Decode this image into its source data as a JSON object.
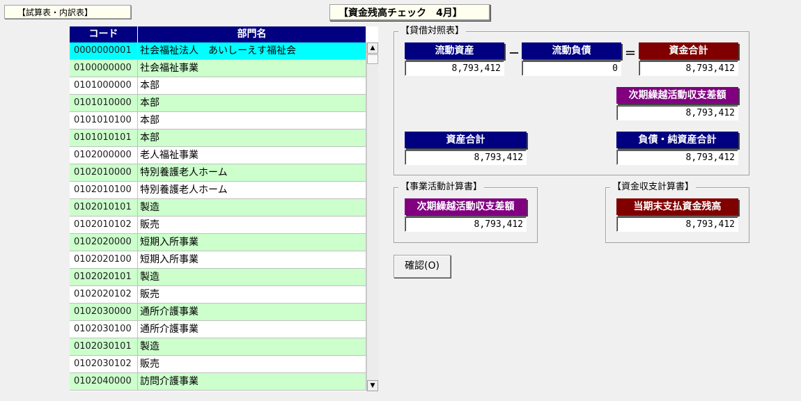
{
  "header": {
    "tab_label": "【試算表・内訳表】",
    "screen_title": "【資金残高チェック　4月】"
  },
  "grid": {
    "columns": [
      "コード",
      "部門名"
    ],
    "rows": [
      {
        "code": "0000000001",
        "name": "社会福祉法人　あいしーえす福祉会",
        "state": "selected"
      },
      {
        "code": "0100000000",
        "name": "社会福祉事業",
        "state": "green"
      },
      {
        "code": "0101000000",
        "name": "本部",
        "state": "white"
      },
      {
        "code": "0101010000",
        "name": "本部",
        "state": "green"
      },
      {
        "code": "0101010100",
        "name": "本部",
        "state": "white"
      },
      {
        "code": "0101010101",
        "name": "本部",
        "state": "green"
      },
      {
        "code": "0102000000",
        "name": "老人福祉事業",
        "state": "white"
      },
      {
        "code": "0102010000",
        "name": "特別養護老人ホーム",
        "state": "green"
      },
      {
        "code": "0102010100",
        "name": "特別養護老人ホーム",
        "state": "white"
      },
      {
        "code": "0102010101",
        "name": "製造",
        "state": "green"
      },
      {
        "code": "0102010102",
        "name": "販売",
        "state": "white"
      },
      {
        "code": "0102020000",
        "name": "短期入所事業",
        "state": "green"
      },
      {
        "code": "0102020100",
        "name": "短期入所事業",
        "state": "white"
      },
      {
        "code": "0102020101",
        "name": "製造",
        "state": "green"
      },
      {
        "code": "0102020102",
        "name": "販売",
        "state": "white"
      },
      {
        "code": "0102030000",
        "name": "通所介護事業",
        "state": "green"
      },
      {
        "code": "0102030100",
        "name": "通所介護事業",
        "state": "white"
      },
      {
        "code": "0102030101",
        "name": "製造",
        "state": "green"
      },
      {
        "code": "0102030102",
        "name": "販売",
        "state": "white"
      },
      {
        "code": "0102040000",
        "name": "訪問介護事業",
        "state": "green"
      }
    ]
  },
  "balance_sheet": {
    "title": "【貸借対照表】",
    "current_assets_label": "流動資産",
    "current_assets_value": "8,793,412",
    "minus_op": "－",
    "current_liabilities_label": "流動負債",
    "current_liabilities_value": "0",
    "equals_op": "＝",
    "fund_total_label": "資金合計",
    "fund_total_value": "8,793,412",
    "carryover_label": "次期繰越活動収支差額",
    "carryover_value": "8,793,412",
    "total_assets_label": "資産合計",
    "total_assets_value": "8,793,412",
    "total_liab_net_label": "負債・純資産合計",
    "total_liab_net_value": "8,793,412"
  },
  "activity_statement": {
    "title": "【事業活動計算書】",
    "carryover_label": "次期繰越活動収支差額",
    "carryover_value": "8,793,412"
  },
  "cashflow_statement": {
    "title": "【資金収支計算書】",
    "ending_balance_label": "当期末支払資金残高",
    "ending_balance_value": "8,793,412"
  },
  "actions": {
    "confirm_label": "確認(O)"
  },
  "colors": {
    "navy": "#000080",
    "maroon": "#800000",
    "purple": "#800080",
    "row_green": "#ccffcc",
    "row_selected": "#00ffff"
  }
}
